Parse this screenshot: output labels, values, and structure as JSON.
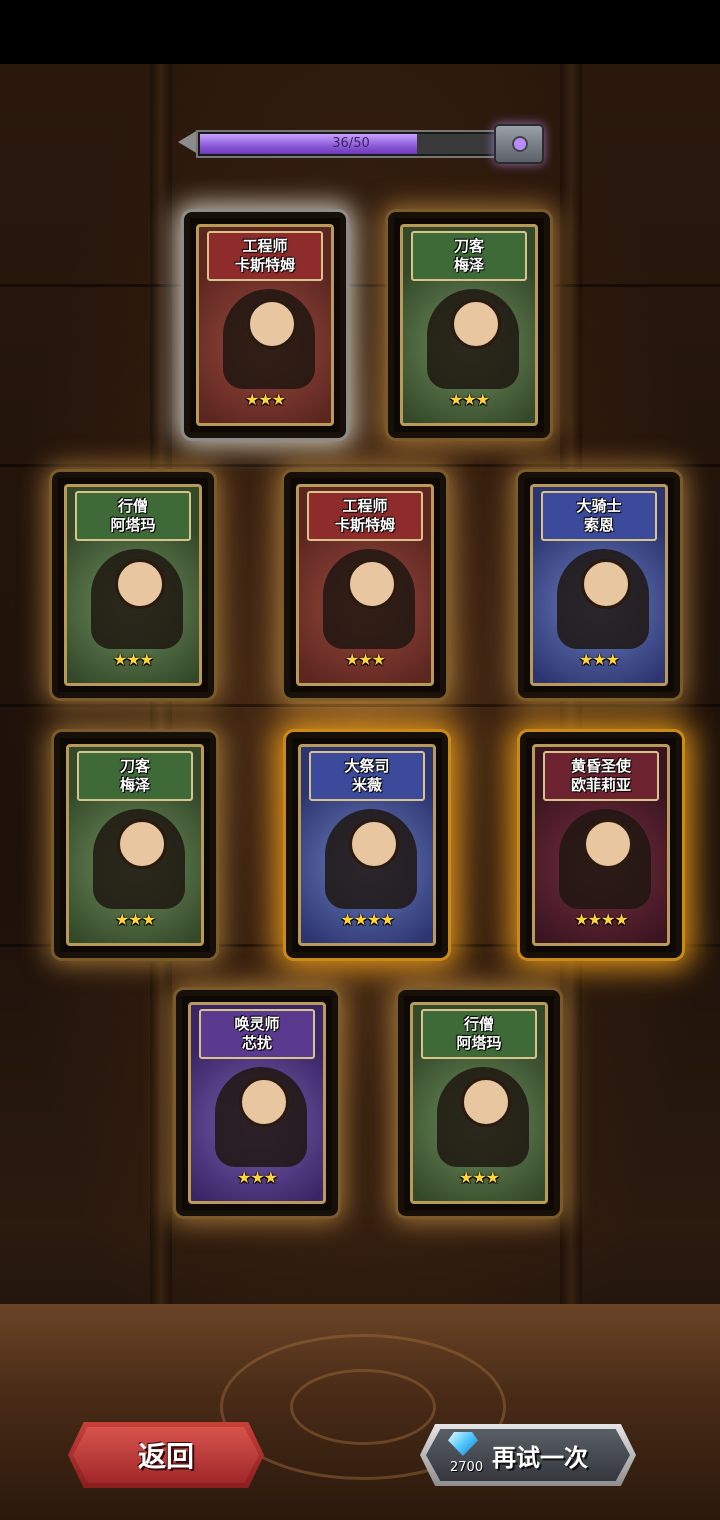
{
  "progress": {
    "text": "36/50",
    "current": 36,
    "max": 50
  },
  "cards": [
    {
      "title": "工程师",
      "name": "卡斯特姆",
      "stars": "★★★",
      "theme": "red"
    },
    {
      "title": "刀客",
      "name": "梅泽",
      "stars": "★★★",
      "theme": "green"
    },
    {
      "title": "行僧",
      "name": "阿塔玛",
      "stars": "★★★",
      "theme": "green"
    },
    {
      "title": "工程师",
      "name": "卡斯特姆",
      "stars": "★★★",
      "theme": "red"
    },
    {
      "title": "大骑士",
      "name": "索恩",
      "stars": "★★★",
      "theme": "blue"
    },
    {
      "title": "刀客",
      "name": "梅泽",
      "stars": "★★★",
      "theme": "green"
    },
    {
      "title": "大祭司",
      "name": "米薇",
      "stars": "★★★★",
      "theme": "blue"
    },
    {
      "title": "黄昏圣使",
      "name": "欧菲莉亚",
      "stars": "★★★★",
      "theme": "darkred"
    },
    {
      "title": "唤灵师",
      "name": "芯扰",
      "stars": "★★★",
      "theme": "purple"
    },
    {
      "title": "行僧",
      "name": "阿塔玛",
      "stars": "★★★",
      "theme": "green"
    }
  ],
  "buttons": {
    "back_label": "返回",
    "retry_label": "再试一次",
    "retry_cost": "2700",
    "cost_icon": "diamond-icon"
  }
}
